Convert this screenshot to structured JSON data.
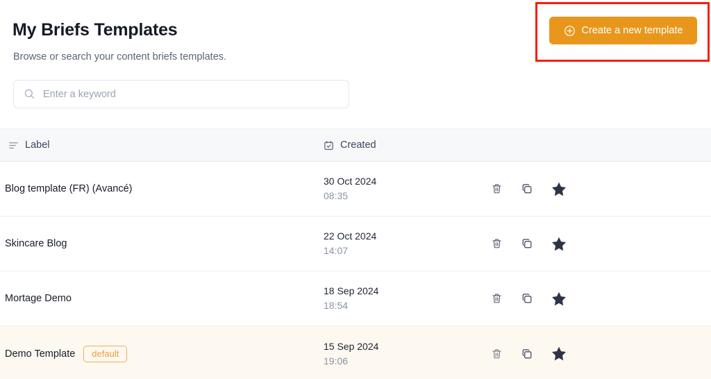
{
  "header": {
    "title": "My Briefs Templates",
    "subtitle": "Browse or search your content briefs templates.",
    "create_button": {
      "label": "Create a new template",
      "icon": "plus-circle-icon",
      "color": "#e8971c"
    },
    "annotation": {
      "color": "#fb1b0a"
    }
  },
  "search": {
    "placeholder": "Enter a keyword",
    "value": "",
    "icon": "search-icon"
  },
  "table": {
    "columns": [
      {
        "key": "label",
        "label": "Label",
        "icon": "list-lines-icon"
      },
      {
        "key": "created",
        "label": "Created",
        "icon": "calendar-check-icon"
      }
    ],
    "row_actions": [
      {
        "name": "delete",
        "icon": "trash-icon"
      },
      {
        "name": "duplicate",
        "icon": "copy-icon"
      },
      {
        "name": "favorite",
        "icon": "star-filled-icon"
      }
    ],
    "rows": [
      {
        "label": "Blog template (FR) (Avancé)",
        "badge": null,
        "date": "30 Oct 2024",
        "time": "08:35",
        "is_default": false
      },
      {
        "label": "Skincare Blog",
        "badge": null,
        "date": "22 Oct 2024",
        "time": "14:07",
        "is_default": false
      },
      {
        "label": "Mortage Demo",
        "badge": null,
        "date": "18 Sep 2024",
        "time": "18:54",
        "is_default": false
      },
      {
        "label": "Demo Template",
        "badge": "default",
        "date": "15 Sep 2024",
        "time": "19:06",
        "is_default": true
      }
    ]
  },
  "colors": {
    "accent_orange": "#e8971c",
    "badge_orange": "#ef9d38",
    "annotation_red": "#fb1b0a",
    "default_row_bg": "#fdf8f0",
    "header_bg": "#f7f8fa"
  }
}
